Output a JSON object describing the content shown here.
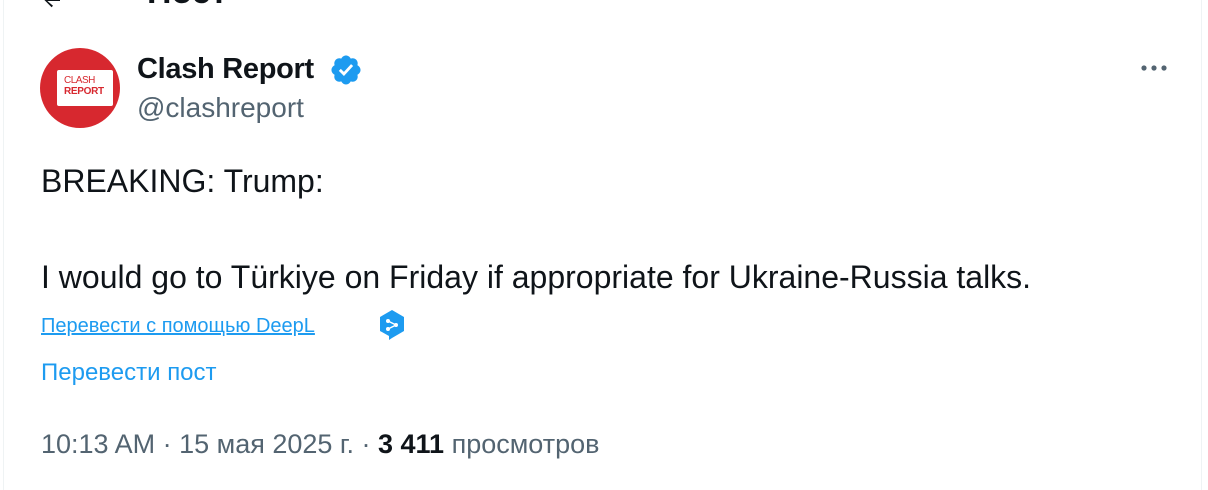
{
  "header": {
    "title": "Пост"
  },
  "post": {
    "author_name": "Clash Report",
    "author_handle": "@clashreport",
    "avatar": {
      "line1": "CLASH",
      "line2": "REPORT",
      "brand_color": "#d7282f"
    },
    "text_line1": "BREAKING: Trump:",
    "text_line2": "I would go to Türkiye on Friday if appropriate for Ukraine-Russia talks.",
    "deepl_link": "Перевести с помощью DeepL",
    "translate_post": "Перевести пост",
    "time": "10:13 AM",
    "separator": "·",
    "date": "15 мая 2025 г.",
    "views_count": "3 411",
    "views_label": "просмотров"
  },
  "colors": {
    "accent": "#1d9bf0",
    "secondary_text": "#536471",
    "verified": "#1d9bf0",
    "deepl": "#0f2b46"
  }
}
